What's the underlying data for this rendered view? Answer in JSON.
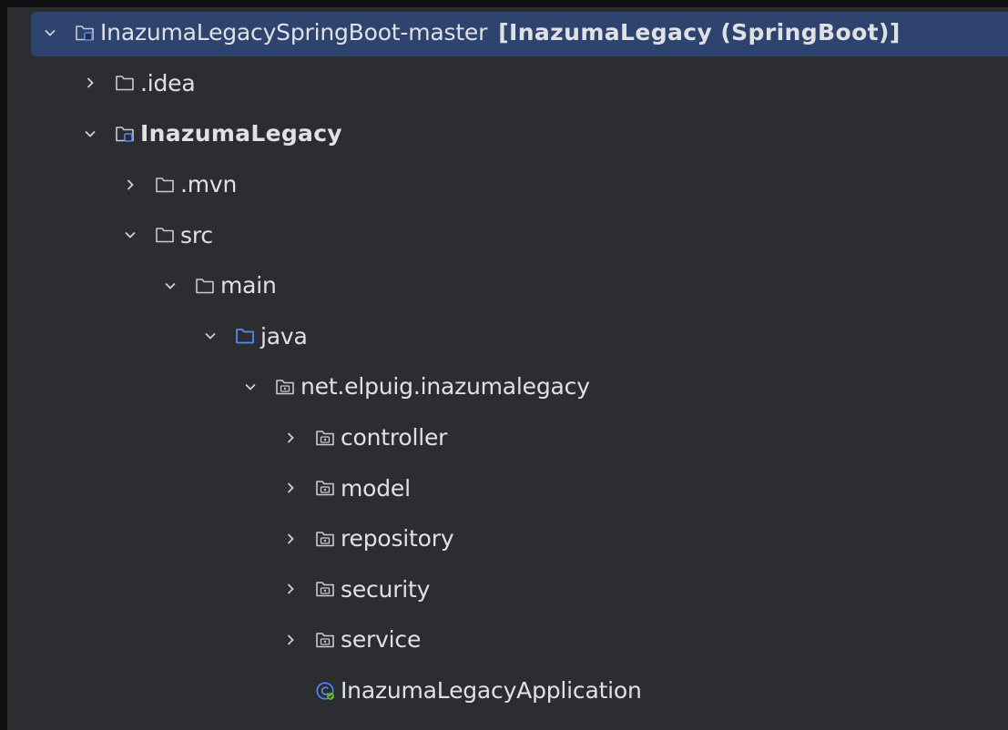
{
  "project_tree": {
    "nodes": [
      {
        "label": "InazumaLegacySpringBoot-master",
        "suffix": "[InazumaLegacy (SpringBoot)]",
        "icon": "module-folder-icon",
        "expanded": true,
        "selected": true
      },
      {
        "label": ".idea",
        "icon": "folder-icon",
        "expanded": false
      },
      {
        "label": "InazumaLegacy",
        "icon": "module-folder-icon",
        "expanded": true
      },
      {
        "label": ".mvn",
        "icon": "folder-icon",
        "expanded": false
      },
      {
        "label": "src",
        "icon": "folder-icon",
        "expanded": true
      },
      {
        "label": "main",
        "icon": "folder-icon",
        "expanded": true
      },
      {
        "label": "java",
        "icon": "source-root-folder-icon",
        "expanded": true
      },
      {
        "label": "net.elpuig.inazumalegacy",
        "icon": "package-icon",
        "expanded": true
      },
      {
        "label": "controller",
        "icon": "package-icon",
        "expanded": false
      },
      {
        "label": "model",
        "icon": "package-icon",
        "expanded": false
      },
      {
        "label": "repository",
        "icon": "package-icon",
        "expanded": false
      },
      {
        "label": "security",
        "icon": "package-icon",
        "expanded": false
      },
      {
        "label": "service",
        "icon": "package-icon",
        "expanded": false
      },
      {
        "label": "InazumaLegacyApplication",
        "icon": "spring-boot-class-icon"
      }
    ]
  },
  "colors": {
    "background": "#2b2d30",
    "selection": "#2e436e",
    "text": "#dfe1e5",
    "folder_outline": "#c9cbcf",
    "source_root": "#548af7"
  }
}
